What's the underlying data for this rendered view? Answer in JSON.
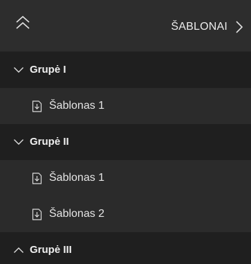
{
  "header": {
    "title": "ŠABLONAI",
    "collapse_icon": "double-chevron-up-icon",
    "expand_icon": "chevron-right-icon"
  },
  "tree": [
    {
      "type": "group",
      "label": "Grupė I",
      "expanded": true
    },
    {
      "type": "item",
      "label": "Šablonas 1"
    },
    {
      "type": "group",
      "label": "Grupė II",
      "expanded": true
    },
    {
      "type": "item",
      "label": "Šablonas 1"
    },
    {
      "type": "item",
      "label": "Šablonas 2"
    },
    {
      "type": "group",
      "label": "Grupė III",
      "expanded": false
    }
  ],
  "colors": {
    "header_bg": "#2d2d2d",
    "group_bg": "#1f1f1f",
    "item_bg": "#2b2b2b",
    "text": "#f0f0f0"
  }
}
